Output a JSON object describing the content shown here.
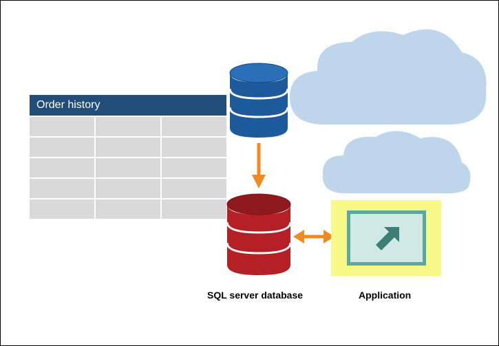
{
  "table": {
    "title": "Order history",
    "columns": 3,
    "rows": 5
  },
  "labels": {
    "sql_server": "SQL server database",
    "application": "Application"
  },
  "icons": {
    "cloud_db": "cloud-database-icon",
    "local_db": "sql-database-icon",
    "app": "application-icon",
    "arrow_down": "arrow-down-icon",
    "arrow_bi": "arrow-bidirectional-icon",
    "cloud_bg": "cloud-icon"
  },
  "colors": {
    "cloud": "#bed5eb",
    "table_header": "#204e79",
    "table_cell": "#d9d9d9",
    "db_blue": "#1d5a9c",
    "db_red": "#b42025",
    "arrow": "#ed8b22",
    "app_highlight": "#f9f98a",
    "app_border": "#58a9a0"
  }
}
